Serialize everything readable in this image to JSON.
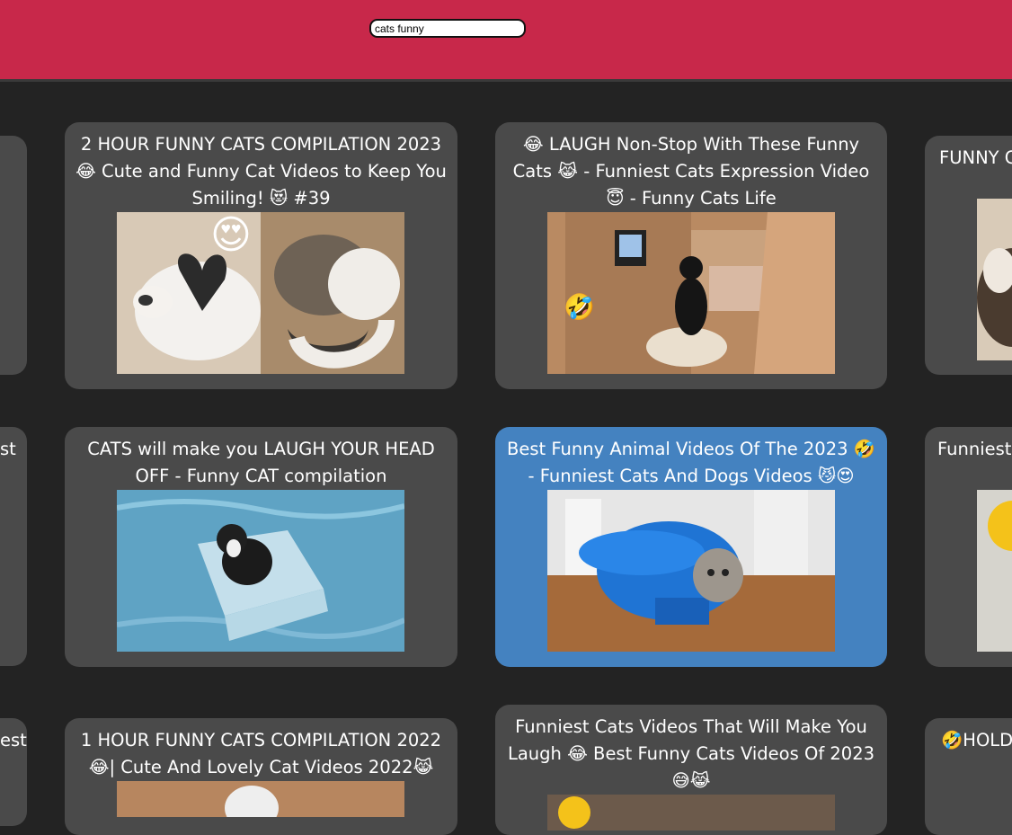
{
  "search": {
    "value": "cats funny",
    "placeholder": ""
  },
  "cards": [
    {
      "title": "2 HOUR FUNNY CATS COMPILATION 2023😂 Cute and Funny Cat Videos to Keep You Smiling! 😻 #39",
      "thumb": "heart-cats"
    },
    {
      "title": "😂 LAUGH Non-Stop With These Funny Cats 😹 - Funniest Cats Expression Video 😇 - Funny Cats Life",
      "thumb": "cat-in-room"
    },
    {
      "title": "CATS will make you LAUGH YOUR HEAD OFF - Funny CAT compilation",
      "thumb": "cat-in-box-water"
    },
    {
      "title": "Best Funny Animal Videos Of The 2023 🤣 - Funniest Cats And Dogs Videos 😼😍",
      "thumb": "cat-in-cap",
      "selected": true
    },
    {
      "title": "1 HOUR FUNNY CATS COMPILATION 2022😂| Cute And Lovely Cat Videos 2022😹",
      "thumb": "cats-row3"
    },
    {
      "title": "Funniest Cats Videos That Will Make You Laugh 😂 Best Funny Cats Videos Of 2023 😅😹",
      "thumb": "cats-row3b"
    }
  ],
  "right_cards": [
    {
      "title": "FUNNY C"
    },
    {
      "title": "Funniest Fu"
    },
    {
      "title": "🤣HOLD thes"
    }
  ],
  "left_cards": [
    {
      "title": ""
    },
    {
      "title": "st"
    },
    {
      "title": "est"
    }
  ],
  "emoji": {
    "heart_eyes": "😍",
    "rofl": "🤣"
  },
  "colors": {
    "header": "#c8284a",
    "background": "#232323",
    "card": "#4a4a4a",
    "card_selected": "#4482c0"
  }
}
